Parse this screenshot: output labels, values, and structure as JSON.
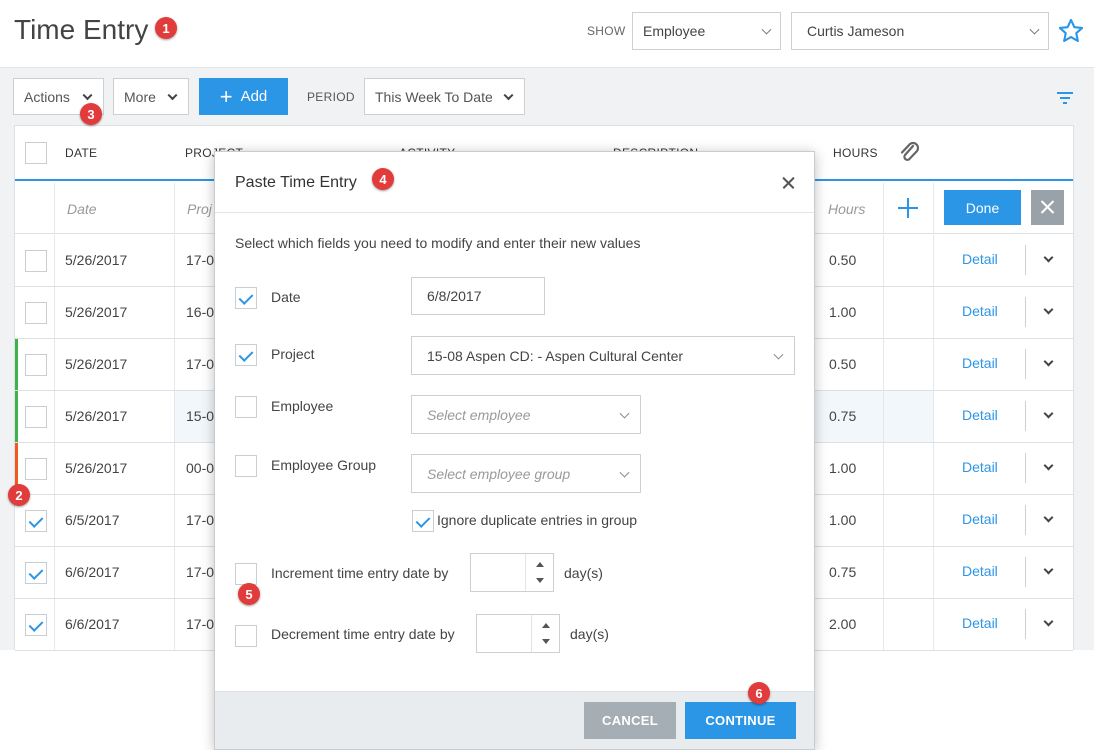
{
  "header": {
    "title": "Time Entry",
    "show_label": "SHOW",
    "show_select": "Employee",
    "employee_select": "Curtis Jameson"
  },
  "toolbar": {
    "actions_label": "Actions",
    "more_label": "More",
    "add_label": "Add",
    "period_label": "PERIOD",
    "period_value": "This Week To Date"
  },
  "grid": {
    "columns": {
      "date": "DATE",
      "project": "PROJECT",
      "activity": "ACTIVITY",
      "description": "DESCRIPTION",
      "hours": "HOURS"
    },
    "edit_row": {
      "date_placeholder": "Date",
      "project_placeholder": "Proj",
      "hours_placeholder": "Hours",
      "done_label": "Done"
    },
    "rows": [
      {
        "date": "5/26/2017",
        "project": "17-0",
        "hours": "0.50",
        "detail": "Detail",
        "checked": false
      },
      {
        "date": "5/26/2017",
        "project": "16-0",
        "hours": "1.00",
        "detail": "Detail",
        "checked": false
      },
      {
        "date": "5/26/2017",
        "project": "17-0",
        "hours": "0.50",
        "detail": "Detail",
        "checked": false
      },
      {
        "date": "5/26/2017",
        "project": "15-0",
        "hours": "0.75",
        "detail": "Detail",
        "checked": false
      },
      {
        "date": "5/26/2017",
        "project": "00-0",
        "hours": "1.00",
        "detail": "Detail",
        "checked": false
      },
      {
        "date": "6/5/2017",
        "project": "17-0",
        "hours": "1.00",
        "detail": "Detail",
        "checked": true
      },
      {
        "date": "6/6/2017",
        "project": "17-0",
        "hours": "0.75",
        "detail": "Detail",
        "checked": true
      },
      {
        "date": "6/6/2017",
        "project": "17-0",
        "hours": "2.00",
        "detail": "Detail",
        "checked": true
      }
    ]
  },
  "modal": {
    "title": "Paste Time Entry",
    "instructions": "Select which fields you need to modify and enter their new values",
    "date_label": "Date",
    "date_value": "6/8/2017",
    "project_label": "Project",
    "project_value": "15-08 Aspen CD: - Aspen Cultural Center",
    "employee_label": "Employee",
    "employee_placeholder": "Select employee",
    "employee_group_label": "Employee Group",
    "employee_group_placeholder": "Select employee group",
    "ignore_duplicates_label": "Ignore duplicate entries in group",
    "increment_label": "Increment time entry date by",
    "decrement_label": "Decrement time entry date by",
    "days_unit": "day(s)",
    "cancel_label": "CANCEL",
    "continue_label": "CONTINUE"
  },
  "badges": [
    "1",
    "2",
    "3",
    "4",
    "5",
    "6"
  ],
  "colors": {
    "accent": "#2b95e6",
    "badge": "#e23b3b",
    "stripe_green": "#3cb44b",
    "stripe_orange": "#f05a1e"
  }
}
